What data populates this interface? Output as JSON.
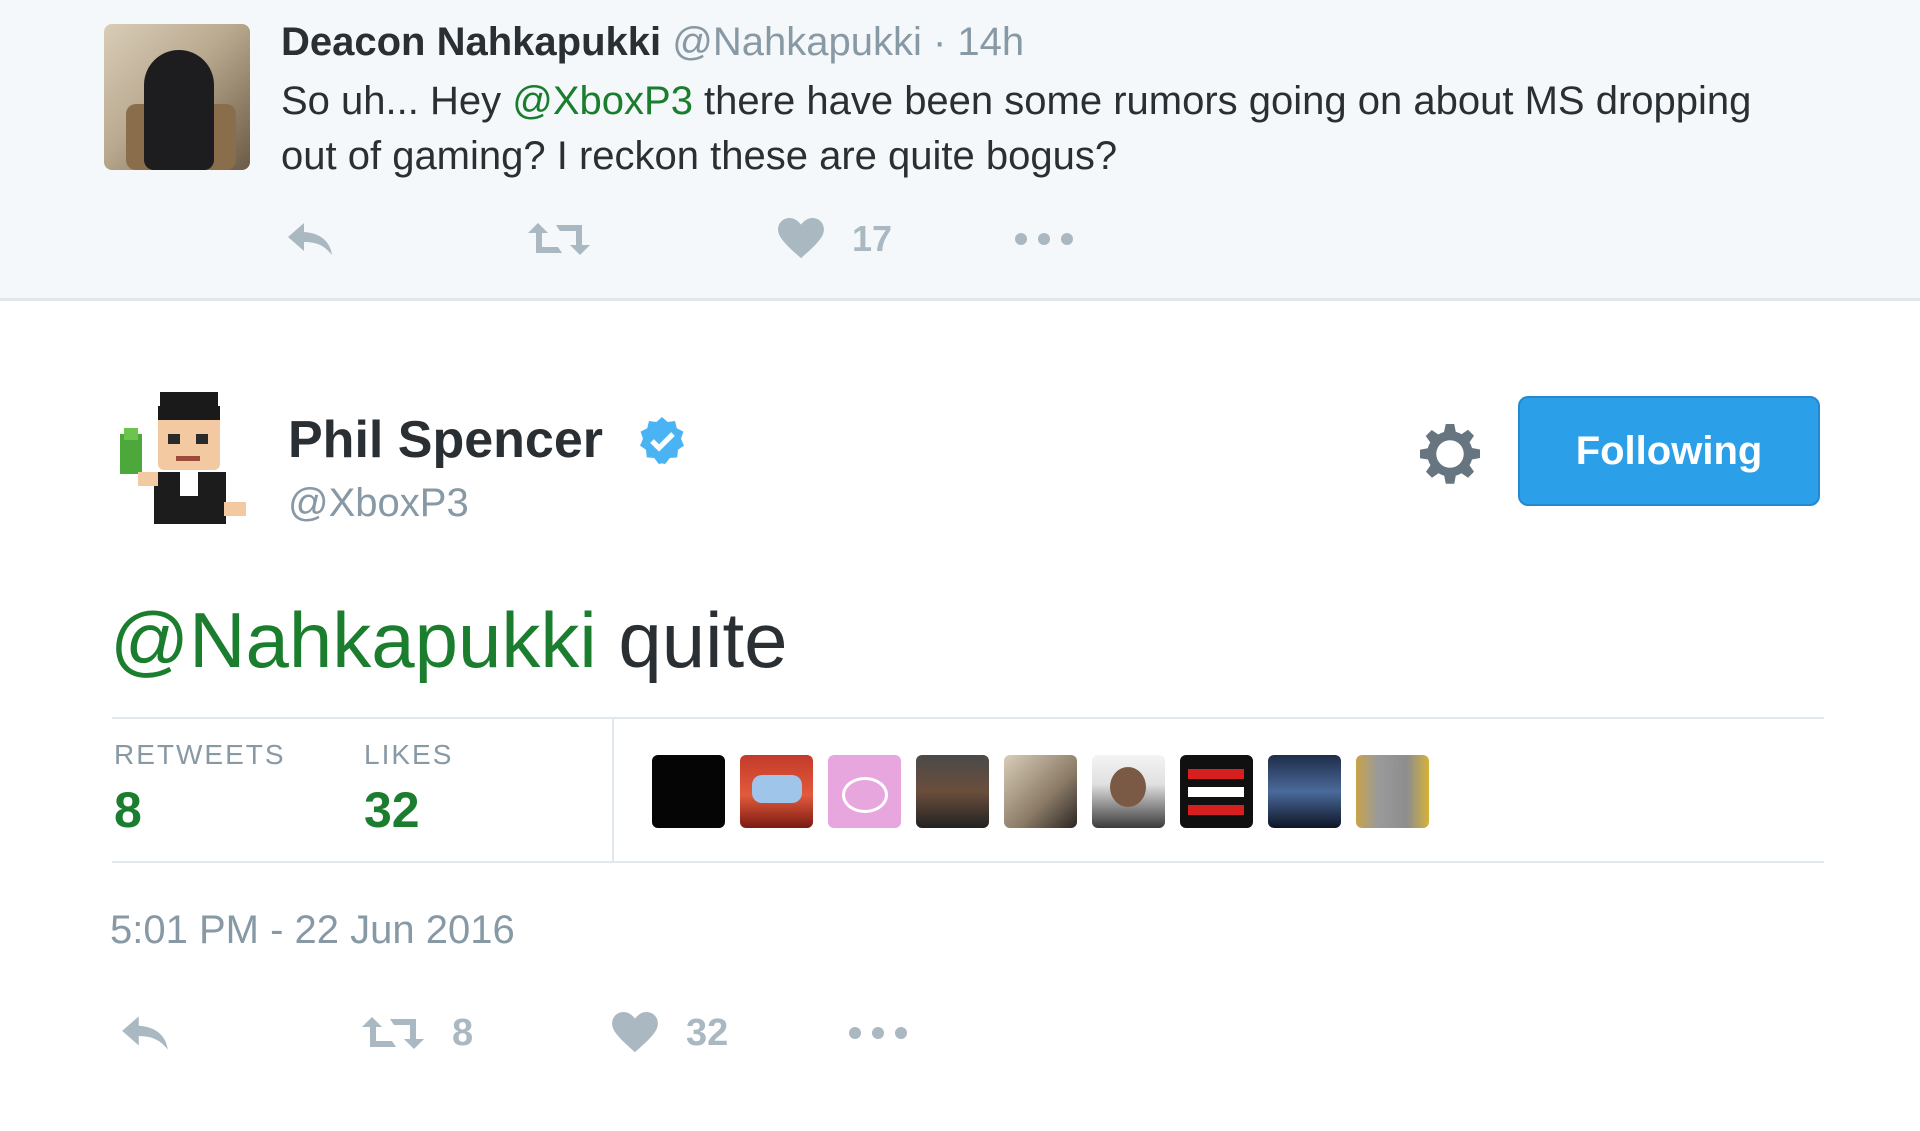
{
  "parent_tweet": {
    "name": "Deacon Nahkapukki",
    "handle": "@Nahkapukki",
    "time": "· 14h",
    "text_before": "So uh... Hey ",
    "mention": "@XboxP3",
    "text_after": " there have been some rumors going on about MS dropping out of gaming? I reckon these are quite bogus?",
    "likes": "17",
    "icons": [
      "reply-icon",
      "retweet-icon",
      "heart-icon",
      "more-icon"
    ]
  },
  "main_tweet": {
    "name": "Phil Spencer",
    "handle": "@XboxP3",
    "follow_label": "Following",
    "mention": "@Nahkapukki",
    "text": " quite",
    "retweets_label": "RETWEETS",
    "retweets": "8",
    "likes_label": "LIKES",
    "likes": "32",
    "date": "5:01 PM - 22 Jun 2016",
    "action_retweets": "8",
    "action_likes": "32",
    "icons": [
      "verified-icon",
      "gear-icon",
      "reply-icon",
      "retweet-icon",
      "heart-icon",
      "more-icon"
    ]
  },
  "colors": {
    "mention": "#1b7d2e",
    "button": "#2b9fe8",
    "muted": "#8899a6",
    "action": "#aab8c2",
    "parent_bg": "#f5f8fa"
  }
}
